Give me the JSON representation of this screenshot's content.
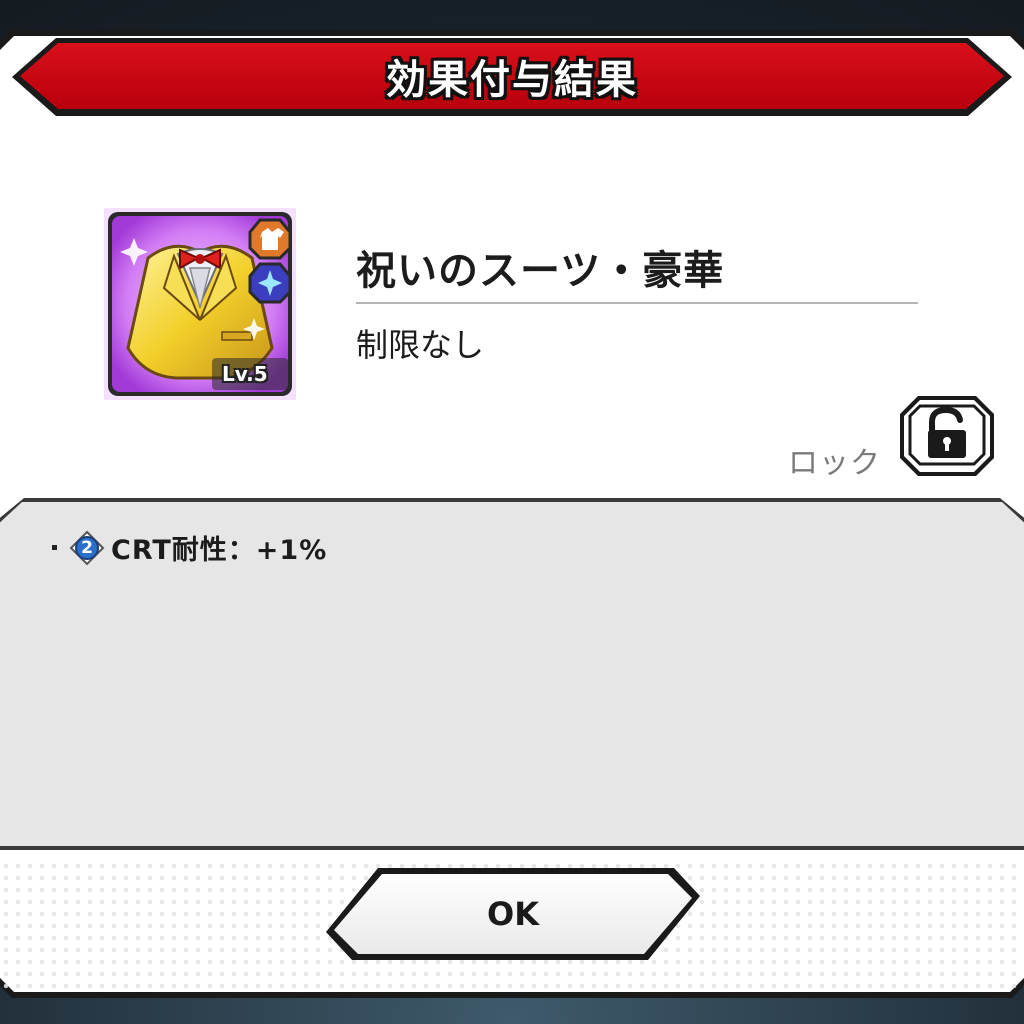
{
  "dialog": {
    "title": "効果付与結果"
  },
  "item": {
    "name": "祝いのスーツ・豪華",
    "restriction": "制限なし",
    "level_label": "Lv.5",
    "icon": "gold-suit-icon",
    "category_icon": "shirt-icon",
    "attribute_icon": "sparkle-icon",
    "frame_color": "#b040e0"
  },
  "lock": {
    "label": "ロック",
    "icon": "unlocked-padlock-icon",
    "state": "unlocked"
  },
  "effects": [
    {
      "rank": "2",
      "text": "CRT耐性：+1%"
    }
  ],
  "buttons": {
    "ok_label": "OK"
  },
  "colors": {
    "banner": "#c8000f",
    "panel": "#ffffff",
    "effects_bg": "#e6e6e6",
    "rank_badge": "#2a6fc9"
  }
}
